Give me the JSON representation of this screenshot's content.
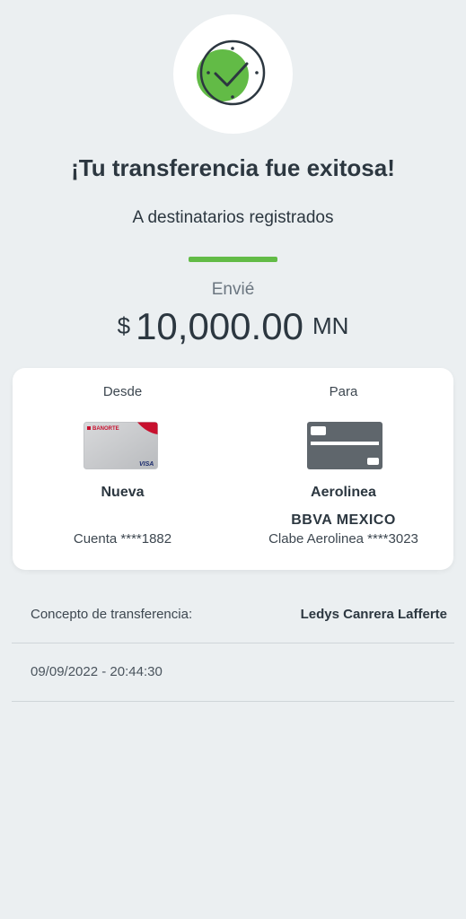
{
  "success": {
    "icon": "check-clock-icon",
    "title": "¡Tu transferencia fue exitosa!",
    "subtitle": "A destinatarios registrados",
    "accent_color": "#62bb46"
  },
  "amount": {
    "label": "Envié",
    "currency": "$",
    "value": "10,000.00",
    "unit": "MN"
  },
  "transfer": {
    "from": {
      "label": "Desde",
      "card_icon": "banorte-card-icon",
      "card_brand_text": "BANORTE",
      "card_network_text": "VISA",
      "name": "Nueva",
      "account": "Cuenta ****1882"
    },
    "to": {
      "label": "Para",
      "card_icon": "generic-card-icon",
      "name": "Aerolinea",
      "bank": "BBVA MEXICO",
      "account": "Clabe Aerolinea ****3023"
    }
  },
  "details": {
    "concept_label": "Concepto de transferencia:",
    "concept_value": "Ledys Canrera Lafferte",
    "datetime": "09/09/2022 - 20:44:30"
  }
}
